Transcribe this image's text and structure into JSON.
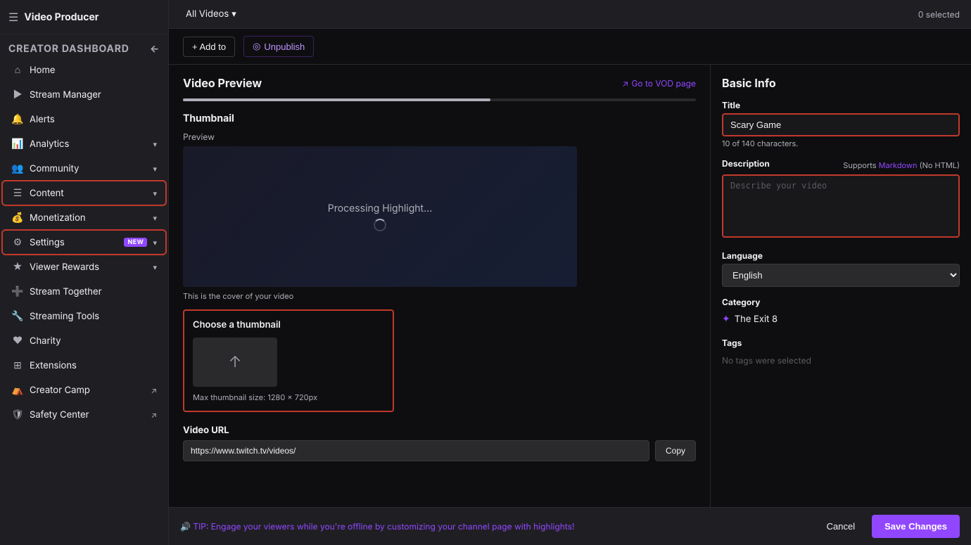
{
  "app": {
    "title": "Video Producer"
  },
  "sidebar": {
    "section_label": "CREATOR DASHBOARD",
    "collapse_icon": "←",
    "items": [
      {
        "id": "home",
        "icon": "⌂",
        "label": "Home",
        "has_arrow": false,
        "badge": null,
        "external": false,
        "active": false
      },
      {
        "id": "stream-manager",
        "icon": "▶",
        "label": "Stream Manager",
        "has_arrow": false,
        "badge": null,
        "external": false,
        "active": false
      },
      {
        "id": "alerts",
        "icon": "🔔",
        "label": "Alerts",
        "has_arrow": false,
        "badge": null,
        "external": false,
        "active": false
      },
      {
        "id": "analytics",
        "icon": "📊",
        "label": "Analytics",
        "has_arrow": true,
        "badge": null,
        "external": false,
        "active": false
      },
      {
        "id": "community",
        "icon": "👥",
        "label": "Community",
        "has_arrow": true,
        "badge": null,
        "external": false,
        "active": false
      },
      {
        "id": "content",
        "icon": "☰",
        "label": "Content",
        "has_arrow": true,
        "badge": null,
        "external": false,
        "active": true
      },
      {
        "id": "monetization",
        "icon": "💰",
        "label": "Monetization",
        "has_arrow": true,
        "badge": null,
        "external": false,
        "active": false
      },
      {
        "id": "settings",
        "icon": "⚙",
        "label": "Settings",
        "has_arrow": true,
        "badge": "NEW",
        "external": false,
        "active": true
      },
      {
        "id": "viewer-rewards",
        "icon": "★",
        "label": "Viewer Rewards",
        "has_arrow": true,
        "badge": null,
        "external": false,
        "active": false
      },
      {
        "id": "stream-together",
        "icon": "➕",
        "label": "Stream Together",
        "has_arrow": false,
        "badge": null,
        "external": false,
        "active": false
      },
      {
        "id": "streaming-tools",
        "icon": "🔧",
        "label": "Streaming Tools",
        "has_arrow": false,
        "badge": null,
        "external": false,
        "active": false
      },
      {
        "id": "charity",
        "icon": "♥",
        "label": "Charity",
        "has_arrow": false,
        "badge": null,
        "external": false,
        "active": false
      },
      {
        "id": "extensions",
        "icon": "⊞",
        "label": "Extensions",
        "has_arrow": false,
        "badge": null,
        "external": false,
        "active": false
      },
      {
        "id": "creator-camp",
        "icon": "⛺",
        "label": "Creator Camp",
        "has_arrow": false,
        "badge": null,
        "external": true,
        "active": false
      },
      {
        "id": "safety-center",
        "icon": "🛡",
        "label": "Safety Center",
        "has_arrow": false,
        "badge": null,
        "external": true,
        "active": false
      }
    ]
  },
  "toolbar": {
    "selected_label": "0 selected",
    "videos_dropdown_label": "All Videos",
    "dropdown_arrow": "▾"
  },
  "action_bar": {
    "add_to_label": "+ Add to",
    "unpublish_icon": "◎",
    "unpublish_label": "Unpublish"
  },
  "video_preview": {
    "panel_title": "Video Preview",
    "go_to_vod_label": "Go to VOD page",
    "go_to_vod_icon": "↗",
    "thumbnail_section_title": "Thumbnail",
    "preview_label": "Preview",
    "processing_text": "Processing Highlight...",
    "cover_caption": "This is the cover of your video",
    "choose_thumbnail_title": "Choose a thumbnail",
    "upload_icon": "↑",
    "thumbnail_size_hint": "Max thumbnail size: 1280 × 720px",
    "video_url_label": "Video URL",
    "video_url_value": "https://www.twitch.tv/videos/",
    "copy_button_label": "Copy"
  },
  "basic_info": {
    "panel_title": "Basic Info",
    "title_label": "Title",
    "title_value": "Scary Game",
    "char_count": "10 of 140 characters.",
    "description_label": "Description",
    "description_markdown": "Supports",
    "description_markdown_link": "Markdown",
    "description_markdown_suffix": "(No HTML)",
    "description_placeholder": "Describe your video",
    "language_label": "Language",
    "language_value": "English",
    "category_label": "Category",
    "category_icon": "✦",
    "category_value": "The Exit 8",
    "tags_label": "Tags",
    "tags_placeholder": "No tags were selected"
  },
  "bottom_bar": {
    "tip_emoji": "🔊",
    "tip_text": "TIP: Engage your viewers while you're offline by customizing your channel page with highlights!",
    "cancel_label": "Cancel",
    "save_label": "Save Changes"
  },
  "colors": {
    "accent_purple": "#9147ff",
    "accent_red": "#c0392b",
    "bg_dark": "#0e0e10",
    "bg_sidebar": "#1f1f23"
  }
}
